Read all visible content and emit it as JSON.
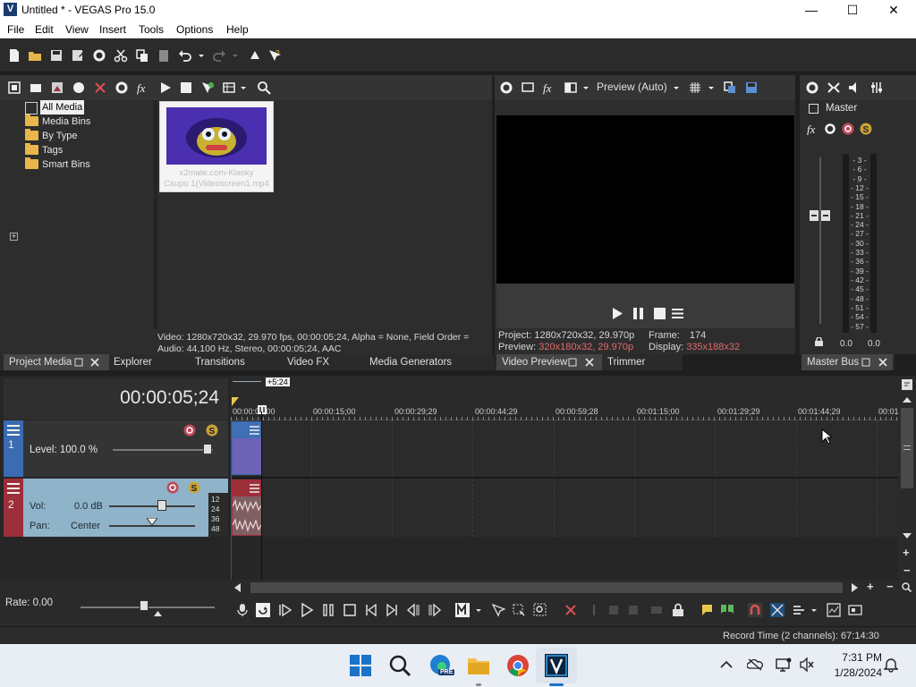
{
  "window": {
    "app_icon_letter": "V",
    "title": "Untitled * - VEGAS Pro 15.0",
    "minimize": "—",
    "maximize": "☐",
    "close": "✕"
  },
  "menu": [
    "File",
    "Edit",
    "View",
    "Insert",
    "Tools",
    "Options",
    "Help"
  ],
  "project_media": {
    "tree": [
      {
        "label": "All Media",
        "expander": ""
      },
      {
        "label": "Media Bins",
        "expander": ""
      },
      {
        "label": "By Type",
        "expander": "+"
      },
      {
        "label": "Tags",
        "expander": ""
      },
      {
        "label": "Smart Bins",
        "expander": ""
      }
    ],
    "thumbnail_caption_line1": "x2mate.com-Klasky",
    "thumbnail_caption_line2": "Csupo 1(Videoscreen1.mp4",
    "info_video": "Video: 1280x720x32, 29.970 fps, 00:00:05;24, Alpha = None, Field Order =",
    "info_audio": "Audio: 44,100 Hz, Stereo, 00:00:05;24, AAC"
  },
  "dock_tabs_left": {
    "project_media": "Project Media",
    "explorer": "Explorer",
    "transitions": "Transitions",
    "video_fx": "Video FX",
    "media_generators": "Media Generators"
  },
  "preview": {
    "quality": "Preview (Auto)",
    "project_label": "Project:",
    "project_value": "1280x720x32, 29.970p",
    "preview_label": "Preview:",
    "preview_value": "320x180x32, 29.970p",
    "frame_label": "Frame:",
    "frame_value": "174",
    "display_label": "Display:",
    "display_value": "335x188x32",
    "tab_video_preview": "Video Preview",
    "tab_trimmer": "Trimmer"
  },
  "master": {
    "label": "Master",
    "meter_ticks": [
      "3",
      "6",
      "9",
      "12",
      "15",
      "18",
      "21",
      "24",
      "27",
      "30",
      "33",
      "36",
      "39",
      "42",
      "45",
      "48",
      "51",
      "54",
      "57"
    ],
    "left_value": "0.0",
    "right_value": "0.0",
    "tab": "Master Bus"
  },
  "timeline": {
    "timecode": "00:00:05;24",
    "cursor_offset": "+5:24",
    "ruler": [
      "00:00:00;00",
      "00:00:15;00",
      "00:00:29;29",
      "00:00:44;29",
      "00:00:59;28",
      "00:01:15;00",
      "00:01:29;29",
      "00:01:44;29",
      "00:01:"
    ],
    "track1": {
      "number": "1",
      "level": "Level: 100.0 %"
    },
    "track2": {
      "number": "2",
      "vol_label": "Vol:",
      "vol_value": "0.0 dB",
      "pan_label": "Pan:",
      "pan_value": "Center",
      "db_marks": [
        "12",
        "24",
        "36",
        "48"
      ]
    },
    "rate": "Rate: 0.00"
  },
  "status": {
    "record_time": "Record Time (2 channels): 67:14:30"
  },
  "taskbar": {
    "time": "7:31 PM",
    "date": "1/28/2024",
    "pre_badge": "PRE"
  },
  "colors": {
    "accent_blue": "#4a7dbd",
    "video_track": "#3b6bb0",
    "audio_track": "#9c2f3a",
    "preview_highlight": "#e06a6a"
  }
}
